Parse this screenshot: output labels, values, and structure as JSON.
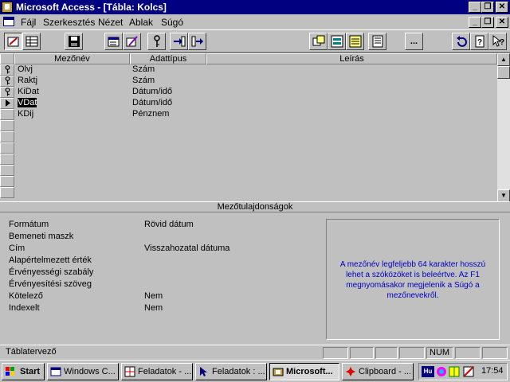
{
  "window": {
    "title": "Microsoft Access - [Tábla: Kolcs]",
    "controls": {
      "minimize": "_",
      "restore": "❐",
      "close": "✕"
    }
  },
  "menu": {
    "items": [
      {
        "label": "Fájl"
      },
      {
        "label": "Szerkesztés"
      },
      {
        "label": "Nézet"
      },
      {
        "label": "Ablak"
      },
      {
        "label": "Súgó"
      }
    ]
  },
  "toolbar": {
    "buttons": [
      {
        "name": "design-view",
        "icon": "design-view-icon"
      },
      {
        "name": "datasheet-view",
        "icon": "datasheet-icon"
      },
      {
        "name": "save",
        "icon": "floppy-icon"
      },
      {
        "name": "properties",
        "icon": "properties-icon"
      },
      {
        "name": "build",
        "icon": "build-icon"
      },
      {
        "name": "primary-key",
        "icon": "key-icon"
      },
      {
        "name": "insert-row",
        "icon": "insert-row-icon"
      },
      {
        "name": "delete-row",
        "icon": "delete-row-icon"
      },
      {
        "name": "new-query",
        "icon": "query-icon"
      },
      {
        "name": "new-form",
        "icon": "form-icon"
      },
      {
        "name": "new-report",
        "icon": "report-icon"
      },
      {
        "name": "database-window",
        "icon": "database-icon"
      },
      {
        "name": "builder",
        "label": "..."
      },
      {
        "name": "undo",
        "icon": "undo-icon"
      },
      {
        "name": "cue-cards",
        "icon": "help-icon"
      },
      {
        "name": "help-pointer",
        "icon": "help-pointer-icon"
      }
    ]
  },
  "table": {
    "columns": [
      "Mezőnév",
      "Adattípus",
      "Leírás"
    ],
    "rows": [
      {
        "field": "Olvj",
        "type": "Szám",
        "description": "",
        "key": true,
        "current": false,
        "selected": false
      },
      {
        "field": "Raktj",
        "type": "Szám",
        "description": "",
        "key": true,
        "current": false,
        "selected": false
      },
      {
        "field": "KiDat",
        "type": "Dátum/idő",
        "description": "",
        "key": true,
        "current": false,
        "selected": false
      },
      {
        "field": "VDat",
        "type": "Dátum/idő",
        "description": "",
        "key": false,
        "current": true,
        "selected": true
      },
      {
        "field": "KDij",
        "type": "Pénznem",
        "description": "",
        "key": false,
        "current": false,
        "selected": false
      }
    ]
  },
  "properties": {
    "header": "Mezőtulajdonságok",
    "items": [
      {
        "label": "Formátum",
        "value": "Rövid dátum"
      },
      {
        "label": "Bemeneti maszk",
        "value": ""
      },
      {
        "label": "Cím",
        "value": "Visszahozatal dátuma"
      },
      {
        "label": "Alapértelmezett érték",
        "value": ""
      },
      {
        "label": "Érvényességi szabály",
        "value": ""
      },
      {
        "label": "Érvényesítési szöveg",
        "value": ""
      },
      {
        "label": "Kötelező",
        "value": "Nem"
      },
      {
        "label": "Indexelt",
        "value": "Nem"
      }
    ],
    "help_text": "A mezőnév legfeljebb 64 karakter hosszú lehet a szóközöket is beleértve. Az F1 megnyomásakor megjelenik a Súgó a mezőnevekről."
  },
  "status": {
    "text": "Táblatervező",
    "num": "NUM"
  },
  "taskbar": {
    "start": "Start",
    "tasks": [
      {
        "label": "Windows C...",
        "active": false
      },
      {
        "label": "Feladatok - ...",
        "active": false
      },
      {
        "label": "Feladatok : ...",
        "active": false
      },
      {
        "label": "Microsoft...",
        "active": true
      },
      {
        "label": "Clipboard - ...",
        "active": false
      }
    ],
    "tray": {
      "lang": "Hu",
      "clock": "17:54"
    }
  }
}
